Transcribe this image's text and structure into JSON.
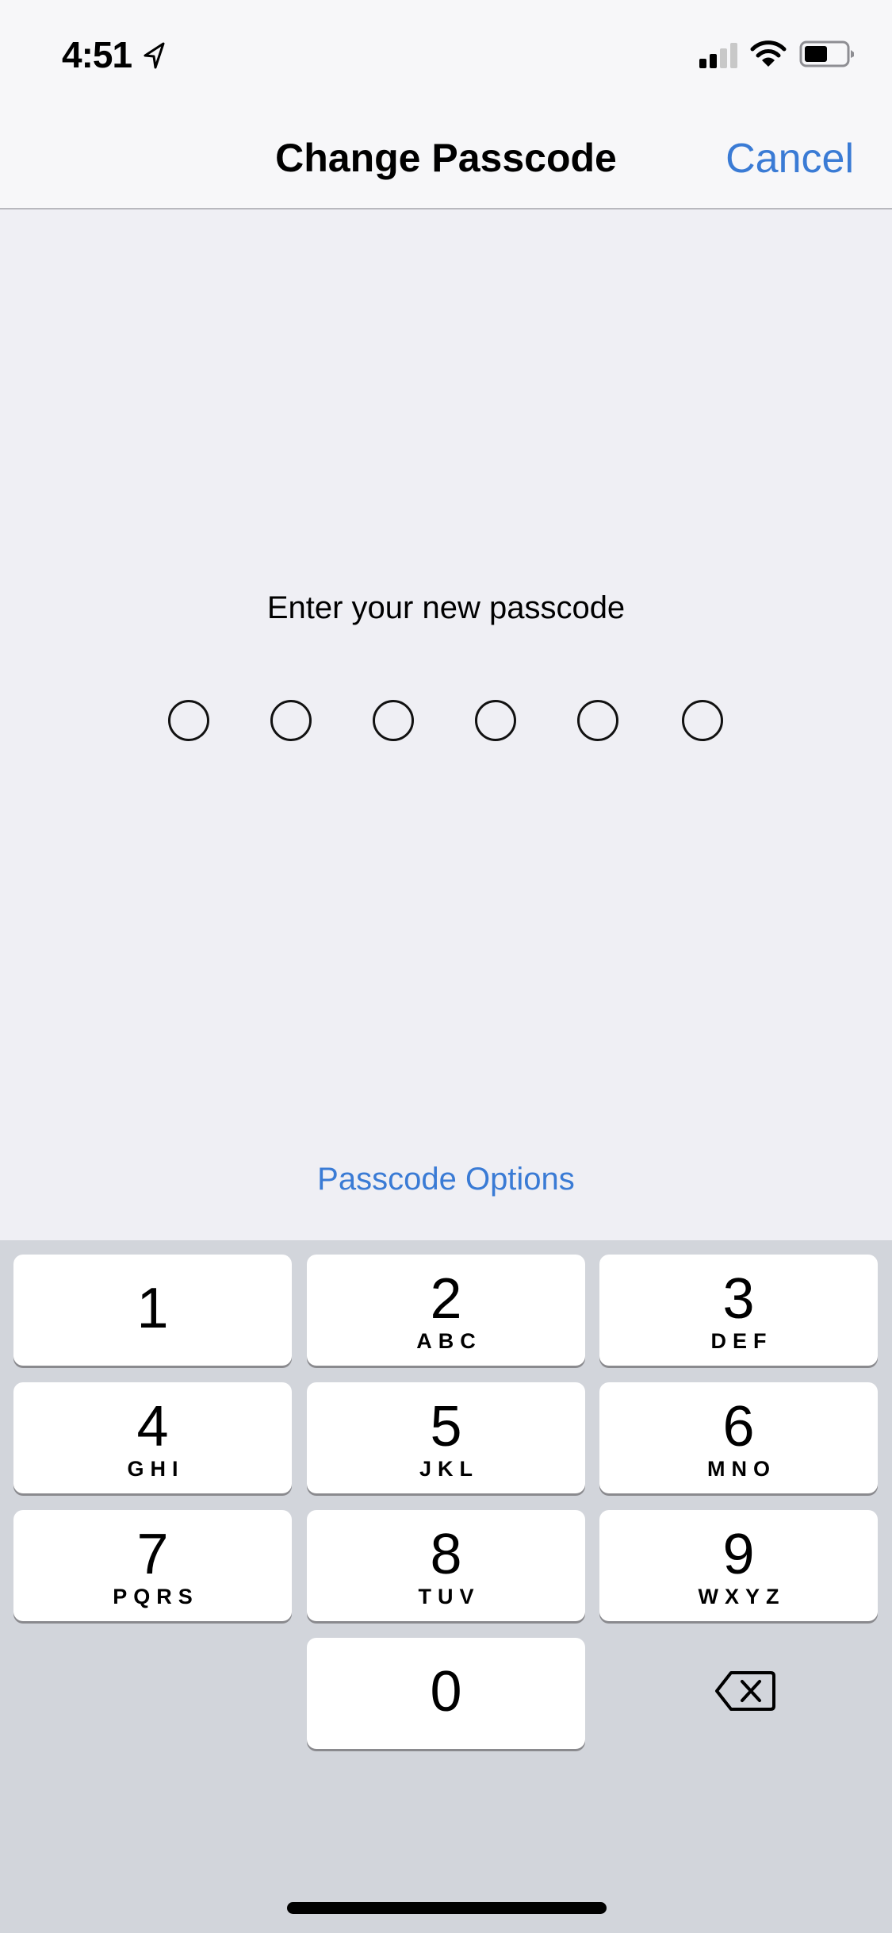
{
  "status_bar": {
    "time": "4:51",
    "location_icon": "location-arrow-icon",
    "signal_bars_active": 2,
    "signal_bars_total": 4,
    "wifi_icon": "wifi-icon",
    "battery_level_percent": 55
  },
  "nav": {
    "title": "Change Passcode",
    "cancel_label": "Cancel"
  },
  "passcode": {
    "prompt": "Enter your new passcode",
    "length": 6,
    "entered": 0
  },
  "options_label": "Passcode Options",
  "keypad": {
    "keys": [
      {
        "digit": "1",
        "letters": ""
      },
      {
        "digit": "2",
        "letters": "ABC"
      },
      {
        "digit": "3",
        "letters": "DEF"
      },
      {
        "digit": "4",
        "letters": "GHI"
      },
      {
        "digit": "5",
        "letters": "JKL"
      },
      {
        "digit": "6",
        "letters": "MNO"
      },
      {
        "digit": "7",
        "letters": "PQRS"
      },
      {
        "digit": "8",
        "letters": "TUV"
      },
      {
        "digit": "9",
        "letters": "WXYZ"
      },
      {
        "digit": "0",
        "letters": ""
      }
    ],
    "backspace_icon": "backspace-icon"
  },
  "colors": {
    "accent": "#3a7bd5",
    "background": "#efeff4",
    "keypad_background": "#d2d5db"
  }
}
